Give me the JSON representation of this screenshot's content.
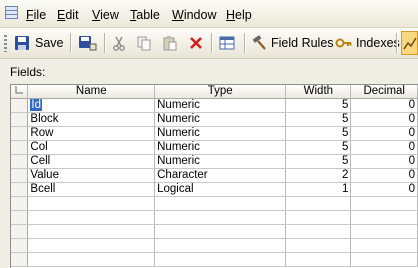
{
  "menu": [
    "File",
    "Edit",
    "View",
    "Table",
    "Window",
    "Help"
  ],
  "menu_underline": [
    "F",
    "E",
    "V",
    "T",
    "W",
    "H"
  ],
  "toolbar": {
    "save_label": "Save",
    "field_rules_label": "Field Rules",
    "indexes_label": "Indexes"
  },
  "fields_label": "Fields:",
  "columns": [
    "Name",
    "Type",
    "Width",
    "Decimal"
  ],
  "rows": [
    {
      "name": "Id",
      "type": "Numeric",
      "width": "5",
      "decimal": "0"
    },
    {
      "name": "Block",
      "type": "Numeric",
      "width": "5",
      "decimal": "0"
    },
    {
      "name": "Row",
      "type": "Numeric",
      "width": "5",
      "decimal": "0"
    },
    {
      "name": "Col",
      "type": "Numeric",
      "width": "5",
      "decimal": "0"
    },
    {
      "name": "Cell",
      "type": "Numeric",
      "width": "5",
      "decimal": "0"
    },
    {
      "name": "Value",
      "type": "Character",
      "width": "2",
      "decimal": "0"
    },
    {
      "name": "Bcell",
      "type": "Logical",
      "width": "1",
      "decimal": "0"
    }
  ],
  "selection_color": "#316ac5"
}
